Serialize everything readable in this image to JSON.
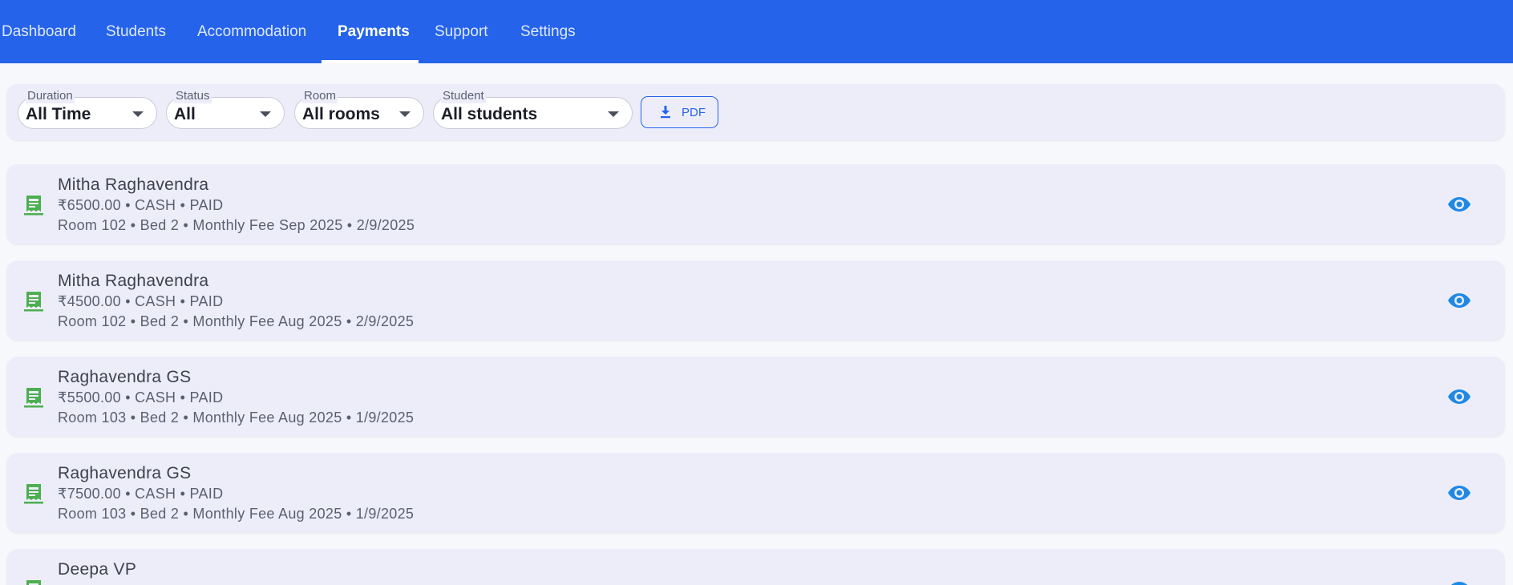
{
  "nav": {
    "tabs": [
      {
        "label": "Dashboard"
      },
      {
        "label": "Students"
      },
      {
        "label": "Accommodation"
      },
      {
        "label": "Payments"
      },
      {
        "label": "Support"
      },
      {
        "label": "Settings"
      }
    ],
    "active_tab": "Payments"
  },
  "filters": {
    "duration": {
      "label": "Duration",
      "value": "All Time"
    },
    "status": {
      "label": "Status",
      "value": "All"
    },
    "room": {
      "label": "Room",
      "value": "All rooms"
    },
    "student": {
      "label": "Student",
      "value": "All students"
    },
    "pdf_button": {
      "label": "PDF",
      "icon": "download-icon"
    }
  },
  "payments": [
    {
      "name": "Mitha Raghavendra",
      "summary": "₹6500.00 • CASH • PAID",
      "details": "Room 102 • Bed 2 • Monthly Fee Sep 2025 • 2/9/2025"
    },
    {
      "name": "Mitha Raghavendra",
      "summary": "₹4500.00 • CASH • PAID",
      "details": "Room 102 • Bed 2 • Monthly Fee Aug 2025 • 2/9/2025"
    },
    {
      "name": "Raghavendra GS",
      "summary": "₹5500.00 • CASH • PAID",
      "details": "Room 103 • Bed 2 • Monthly Fee Aug 2025 • 1/9/2025"
    },
    {
      "name": "Raghavendra GS",
      "summary": "₹7500.00 • CASH • PAID",
      "details": "Room 103 • Bed 2 • Monthly Fee Aug 2025 • 1/9/2025"
    },
    {
      "name": "Deepa VP",
      "summary": "",
      "details": ""
    }
  ],
  "colors": {
    "nav_bg": "#2563eb",
    "page_bg": "#f7f8fc",
    "card_bg": "#ededfa",
    "receipt_icon": "#4caf50",
    "view_icon": "#1e88e5"
  },
  "icons": {
    "row_icon": "receipt-icon",
    "action_icon": "eye-icon"
  }
}
